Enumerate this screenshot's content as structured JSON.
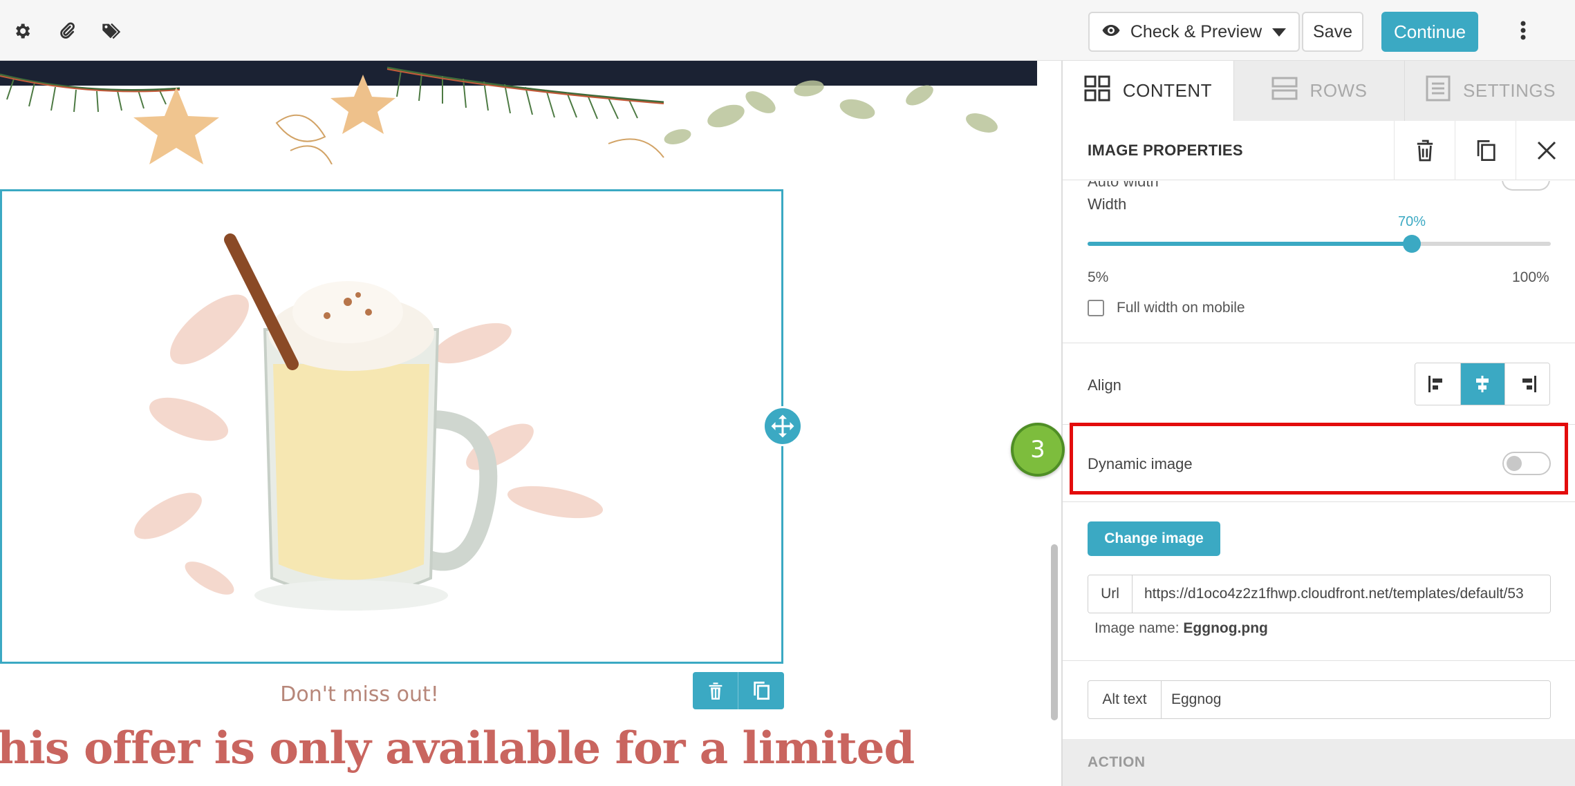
{
  "toolbar": {
    "icons": [
      "gear-icon",
      "paperclip-icon",
      "tags-icon"
    ],
    "preview_label": "Check & Preview",
    "save_label": "Save",
    "continue_label": "Continue",
    "more_icon": "more-vertical-icon"
  },
  "canvas": {
    "image_alt": "Eggnog",
    "tagline": "Don't miss out!",
    "headline": "his offer is only available for a limited"
  },
  "panel": {
    "tabs": [
      {
        "label": "CONTENT",
        "icon": "grid-icon",
        "active": true
      },
      {
        "label": "ROWS",
        "icon": "rows-icon",
        "active": false
      },
      {
        "label": "SETTINGS",
        "icon": "settings-list-icon",
        "active": false
      }
    ],
    "title": "IMAGE PROPERTIES",
    "cut_label": "Auto width",
    "width": {
      "label": "Width",
      "value_text": "70%",
      "value": 0.7,
      "min_label": "5%",
      "max_label": "100%",
      "min": 5,
      "max": 100
    },
    "full_width_mobile": {
      "label": "Full width on mobile",
      "checked": false
    },
    "align": {
      "label": "Align",
      "options": [
        "left",
        "center",
        "right"
      ],
      "selected": "center"
    },
    "dynamic_image": {
      "label": "Dynamic image",
      "enabled": false
    },
    "change_image_label": "Change image",
    "url": {
      "prefix": "Url",
      "value": "https://d1oco4z2z1fhwp.cloudfront.net/templates/default/53"
    },
    "image_name": {
      "label": "Image name:",
      "value": "Eggnog.png"
    },
    "alt_text": {
      "prefix": "Alt text",
      "value": "Eggnog"
    },
    "section_action": "ACTION"
  },
  "annotation": {
    "step_number": "3",
    "highlight_color": "#e30c0c",
    "badge_color": "#7dbd3d"
  },
  "colors": {
    "accent": "#3ba9c3",
    "headline": "#c9655f",
    "tagline": "#b7877a"
  }
}
